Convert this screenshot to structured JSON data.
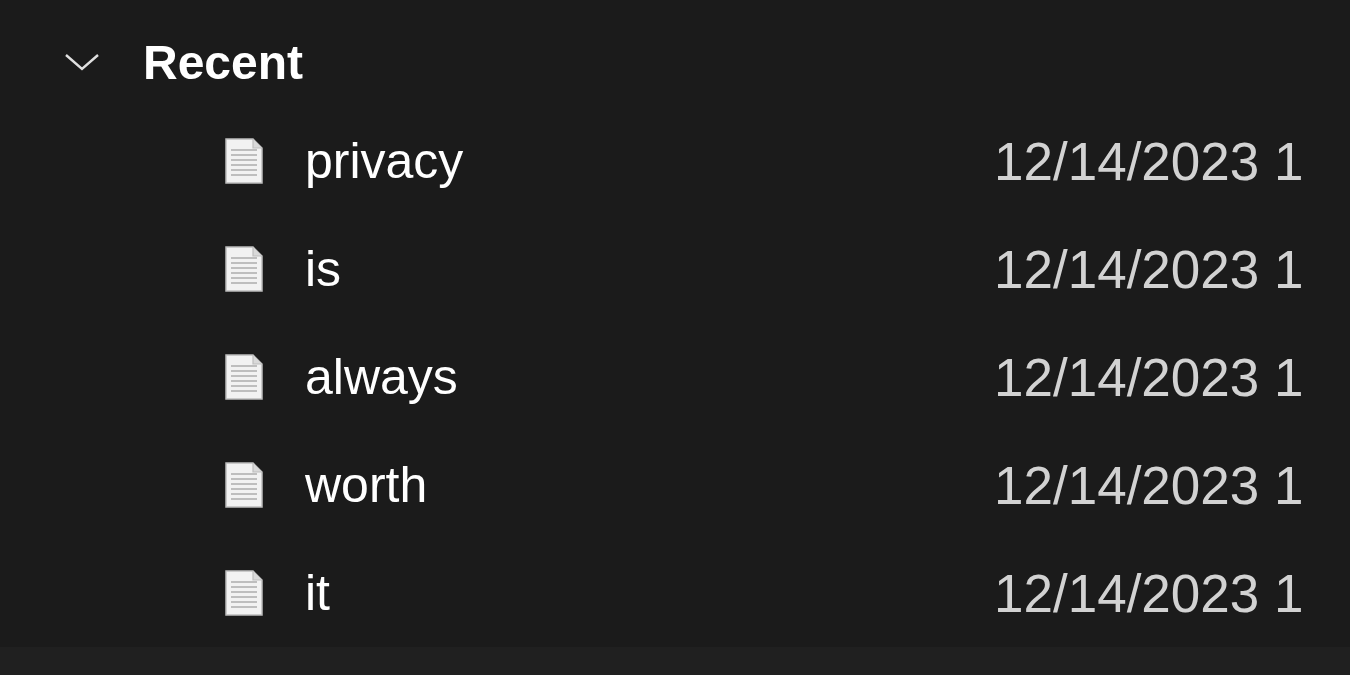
{
  "group": {
    "title": "Recent",
    "expanded": true
  },
  "files": [
    {
      "name": "privacy",
      "date": "12/14/2023 1"
    },
    {
      "name": "is",
      "date": "12/14/2023 1"
    },
    {
      "name": "always",
      "date": "12/14/2023 1"
    },
    {
      "name": "worth",
      "date": "12/14/2023 1"
    },
    {
      "name": "it",
      "date": "12/14/2023 1"
    }
  ]
}
